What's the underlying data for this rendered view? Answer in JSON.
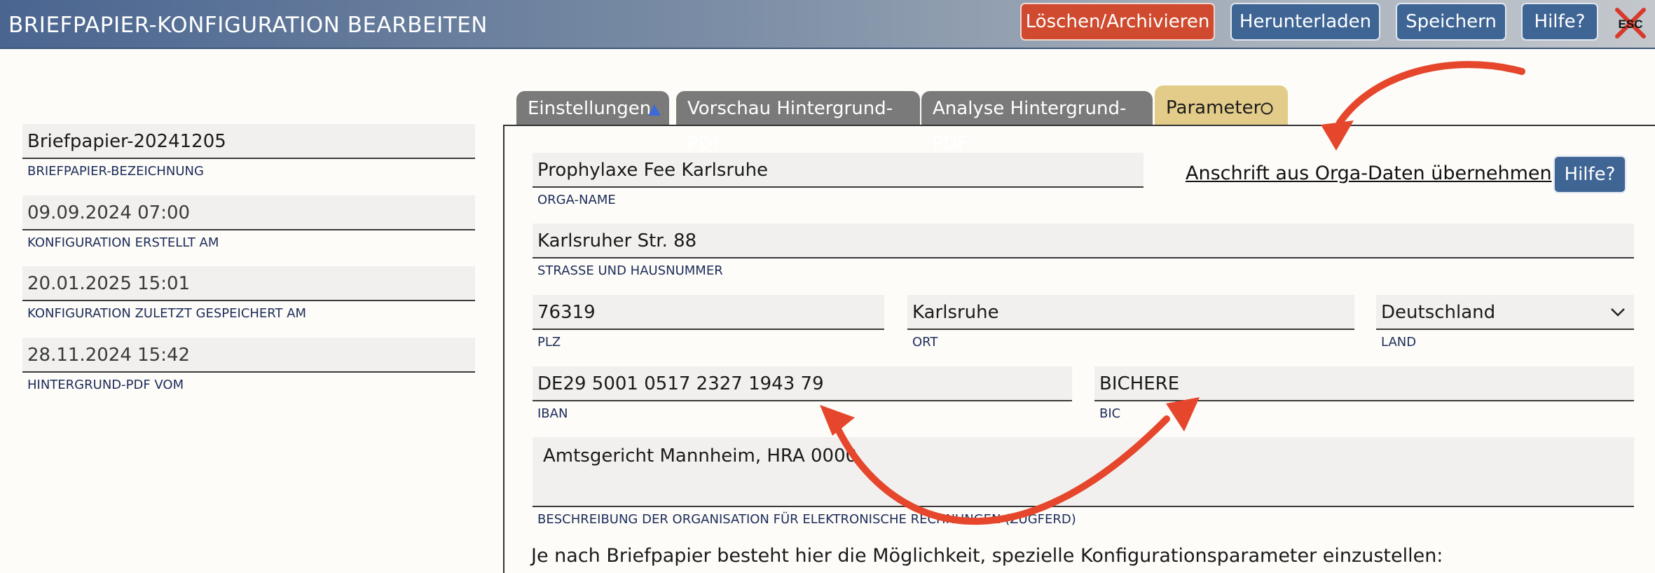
{
  "header": {
    "title": "BRIEFPAPIER-KONFIGURATION BEARBEITEN",
    "buttons": {
      "delete": "Löschen/Archivieren",
      "download": "Herunterladen",
      "save": "Speichern",
      "help": "Hilfe?"
    },
    "esc_label": "ESC"
  },
  "meta": {
    "name": {
      "value": "Briefpapier-20241205",
      "label": "BRIEFPAPIER-BEZEICHNUNG"
    },
    "created": {
      "value": "09.09.2024 07:00",
      "label": "KONFIGURATION ERSTELLT AM"
    },
    "saved": {
      "value": "20.01.2025 15:01",
      "label": "KONFIGURATION ZULETZT GESPEICHERT AM"
    },
    "pdf": {
      "value": "28.11.2024 15:42",
      "label": "HINTERGRUND-PDF VOM"
    }
  },
  "tabs": {
    "settings": "Einstellungen",
    "preview": "Vorschau Hintergrund-PDF",
    "analysis": "Analyse Hintergrund-PDF",
    "params": "Parameter"
  },
  "form": {
    "orga_name": {
      "value": "Prophylaxe Fee Karlsruhe",
      "label": "ORGA-NAME"
    },
    "adopt_link": "Anschrift aus Orga-Daten übernehmen",
    "help": "Hilfe?",
    "street": {
      "value": "Karlsruher Str. 88",
      "label": "STRASSE UND HAUSNUMMER"
    },
    "zip": {
      "value": "76319",
      "label": "PLZ"
    },
    "city": {
      "value": "Karlsruhe",
      "label": "ORT"
    },
    "country": {
      "value": "Deutschland",
      "label": "LAND"
    },
    "iban": {
      "value": "DE29 5001 0517 2327 1943 79",
      "label": "IBAN"
    },
    "bic": {
      "value": "BICHERE",
      "label": "BIC"
    },
    "description": {
      "value": "Amtsgericht Mannheim, HRA 0000",
      "label": "BESCHREIBUNG DER ORGANISATION FÜR ELEKTRONISCHE RECHNUNGEN (ZUGFERD)"
    },
    "intro": "Je nach Briefpapier besteht hier die Möglichkeit, spezielle Konfigurationsparameter einzustellen:"
  },
  "colors": {
    "header_start": "#4a6590",
    "button_blue": "#3f6595",
    "button_red": "#cf4a2e",
    "active_tab": "#e3cc8a",
    "annotation": "#e5462c"
  }
}
